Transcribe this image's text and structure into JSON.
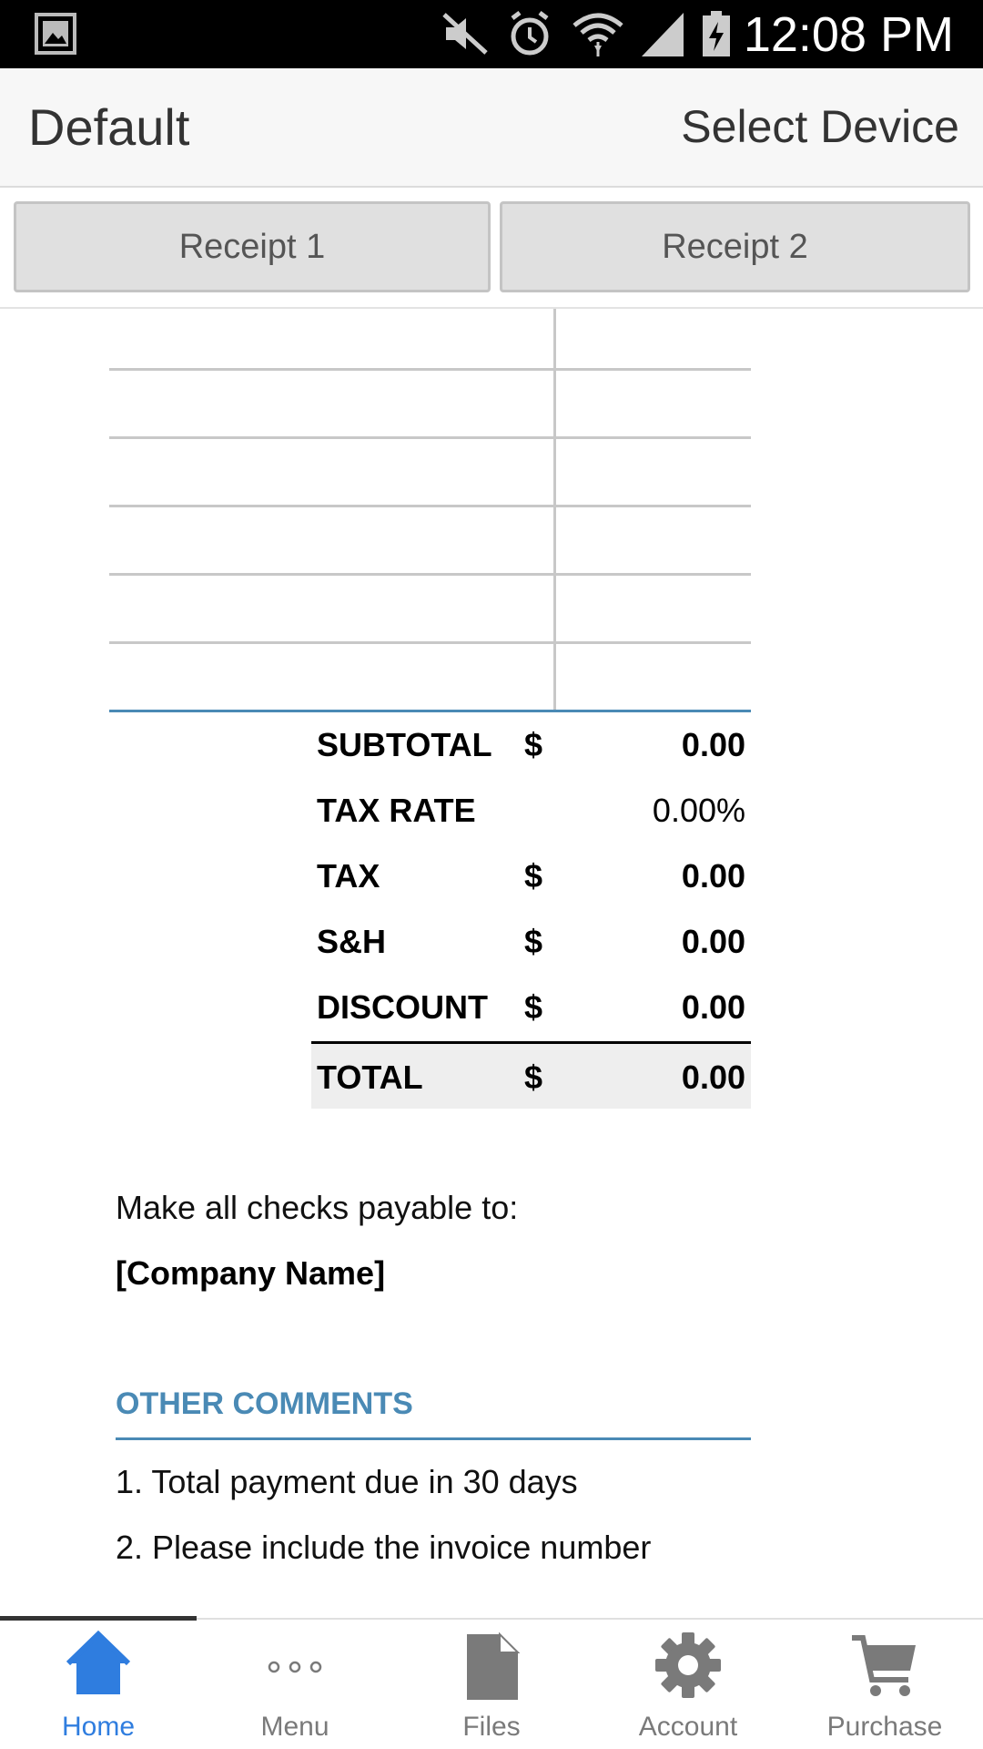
{
  "status_bar": {
    "time": "12:08 PM",
    "icons": [
      "gallery-icon",
      "mute-icon",
      "alarm-icon",
      "wifi-icon",
      "signal-icon",
      "battery-charging-icon"
    ]
  },
  "app_bar": {
    "title": "Default",
    "select_device": "Select Device"
  },
  "tabs": [
    {
      "label": "Receipt 1"
    },
    {
      "label": "Receipt 2"
    }
  ],
  "totals": {
    "rows": [
      {
        "label": "SUBTOTAL",
        "currency": "$",
        "value": "0.00"
      },
      {
        "label": "TAX RATE",
        "currency": "",
        "value": "0.00%"
      },
      {
        "label": "TAX",
        "currency": "$",
        "value": "0.00"
      },
      {
        "label": "S&H",
        "currency": "$",
        "value": "0.00"
      },
      {
        "label": "DISCOUNT",
        "currency": "$",
        "value": "0.00"
      }
    ],
    "total": {
      "label": "TOTAL",
      "currency": "$",
      "value": "0.00"
    }
  },
  "payable": {
    "line1": "Make all checks payable to:",
    "company": "[Company Name]"
  },
  "comments": {
    "heading": "OTHER COMMENTS",
    "items": [
      "1. Total payment due in 30 days",
      "2. Please include the invoice number"
    ]
  },
  "bottom_nav": {
    "active": "Home",
    "items": [
      {
        "label": "Home",
        "icon": "home-icon"
      },
      {
        "label": "Menu",
        "icon": "more-icon"
      },
      {
        "label": "Files",
        "icon": "file-icon"
      },
      {
        "label": "Account",
        "icon": "gear-icon"
      },
      {
        "label": "Purchase",
        "icon": "cart-icon"
      }
    ]
  },
  "colors": {
    "accent_blue": "#2f7ddf",
    "section_blue": "#4a8ab5",
    "status_bar_bg": "#000000",
    "app_bar_bg": "#f7f7f7"
  }
}
